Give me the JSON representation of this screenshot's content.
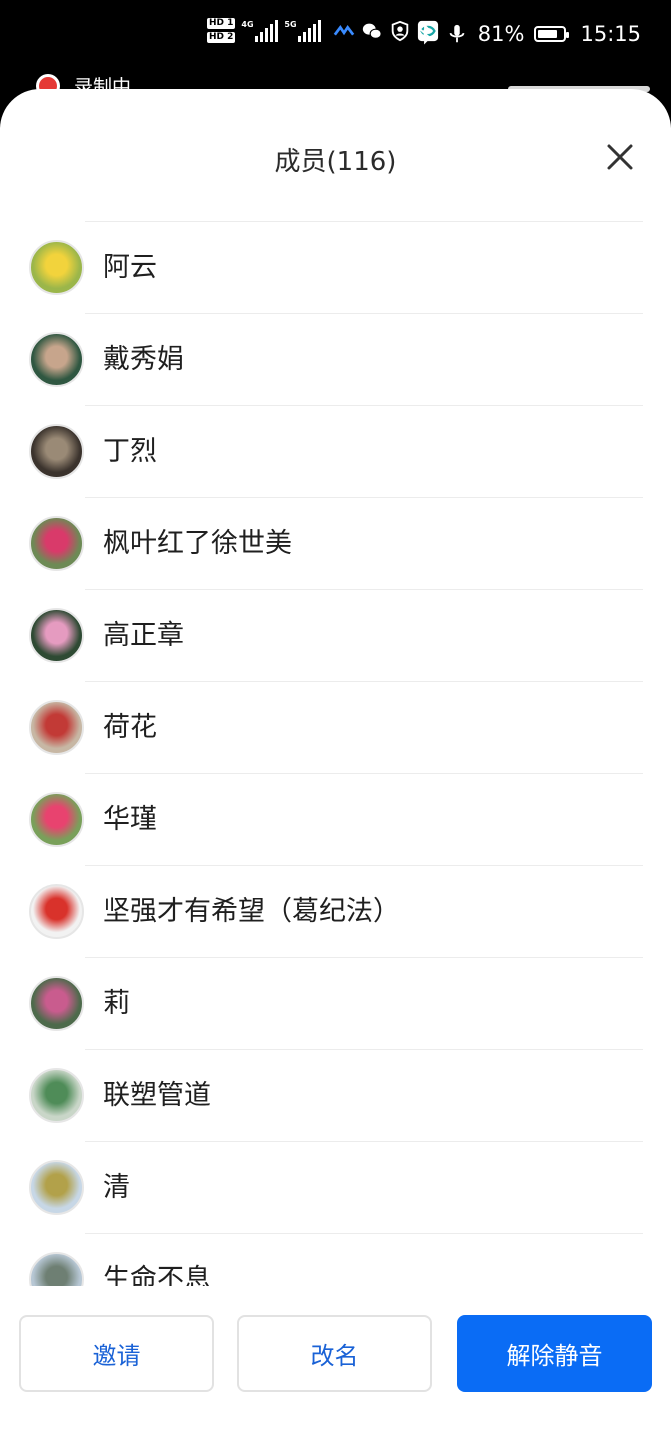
{
  "status_bar": {
    "hd1": "HD 1",
    "hd2": "HD 2",
    "net1": "4G",
    "net2": "5G",
    "battery_pct": "81%",
    "battery_level": 0.81,
    "time": "15:15"
  },
  "recording": {
    "label": "录制中"
  },
  "sheet": {
    "title": "成员(116)"
  },
  "members": [
    {
      "name": "阿云",
      "avatar_colors": [
        "#9bb64a",
        "#f2d33c"
      ]
    },
    {
      "name": "戴秀娟",
      "avatar_colors": [
        "#2f5741",
        "#c7a58c"
      ]
    },
    {
      "name": "丁烈",
      "avatar_colors": [
        "#3b332d",
        "#9a8a76"
      ]
    },
    {
      "name": "枫叶红了徐世美",
      "avatar_colors": [
        "#6d8a55",
        "#d93a6a"
      ]
    },
    {
      "name": "高正章",
      "avatar_colors": [
        "#2e4a33",
        "#e59bc0"
      ]
    },
    {
      "name": "荷花",
      "avatar_colors": [
        "#c7b7a4",
        "#c23a36"
      ]
    },
    {
      "name": "华瑾",
      "avatar_colors": [
        "#79a05a",
        "#e8436f"
      ]
    },
    {
      "name": "坚强才有希望（葛纪法）",
      "avatar_colors": [
        "#f2f2f2",
        "#d9322b"
      ]
    },
    {
      "name": "莉",
      "avatar_colors": [
        "#4d6a4b",
        "#c95c8e"
      ]
    },
    {
      "name": "联塑管道",
      "avatar_colors": [
        "#c9d6c8",
        "#4f8c58"
      ]
    },
    {
      "name": "清",
      "avatar_colors": [
        "#c7d7e6",
        "#b2a14a"
      ]
    },
    {
      "name": "生命不息",
      "avatar_colors": [
        "#b7c7d4",
        "#6e7f73"
      ]
    }
  ],
  "buttons": {
    "invite": "邀请",
    "rename": "改名",
    "unmute": "解除静音"
  },
  "colors": {
    "primary": "#0a6cf5",
    "outline_text": "#1a62d6"
  }
}
